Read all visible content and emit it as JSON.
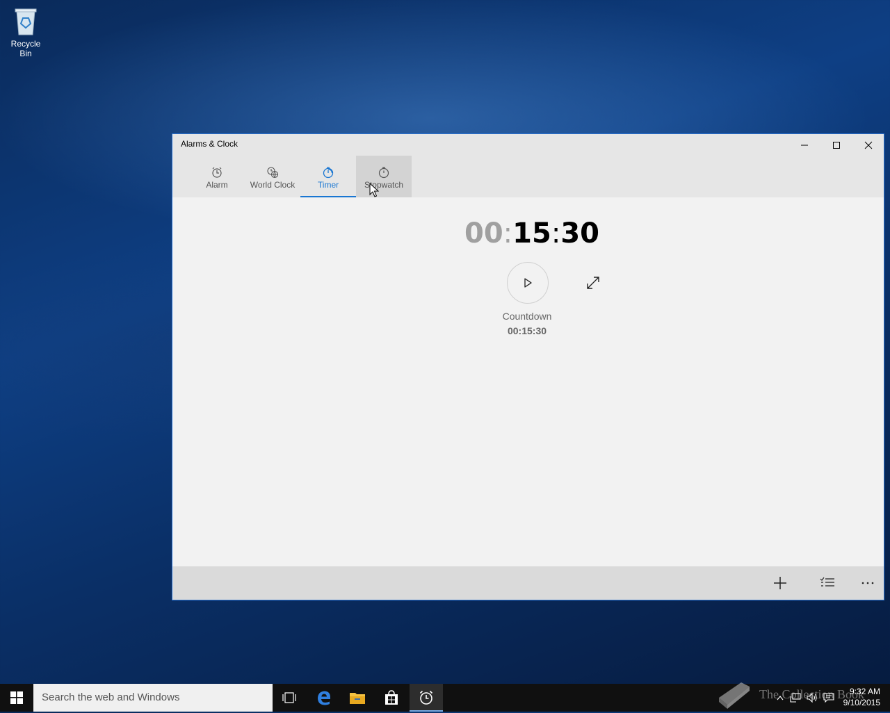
{
  "desktop": {
    "recycle_bin_label": "Recycle Bin"
  },
  "window": {
    "title": "Alarms & Clock",
    "tabs": [
      {
        "label": "Alarm",
        "icon": "alarm-icon"
      },
      {
        "label": "World Clock",
        "icon": "world-clock-icon"
      },
      {
        "label": "Timer",
        "icon": "timer-icon",
        "selected": true
      },
      {
        "label": "Stopwatch",
        "icon": "stopwatch-icon",
        "hovered": true
      }
    ],
    "timer": {
      "hours": "00",
      "minutes": "15",
      "seconds": "30",
      "separator": ":",
      "name": "Countdown",
      "duration": "00:15:30"
    },
    "accent_color": "#1976d2"
  },
  "taskbar": {
    "search_placeholder": "Search the web and Windows",
    "time": "9:32 AM",
    "date": "9/10/2015"
  },
  "watermark": "The Collection Book"
}
